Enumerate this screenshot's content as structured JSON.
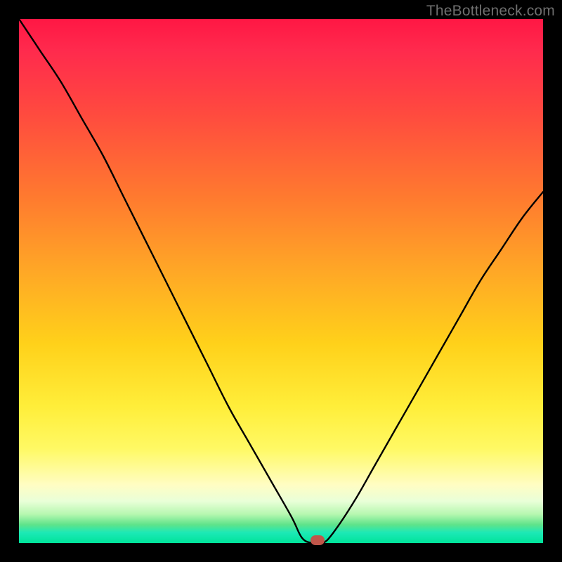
{
  "watermark": "TheBottleneck.com",
  "chart_data": {
    "type": "line",
    "title": "",
    "xlabel": "",
    "ylabel": "",
    "xlim": [
      0,
      100
    ],
    "ylim": [
      0,
      100
    ],
    "grid": false,
    "legend": false,
    "series": [
      {
        "name": "bottleneck-curve",
        "x": [
          0,
          4,
          8,
          12,
          16,
          20,
          24,
          28,
          32,
          36,
          40,
          44,
          48,
          52,
          54,
          56,
          58,
          60,
          64,
          68,
          72,
          76,
          80,
          84,
          88,
          92,
          96,
          100
        ],
        "y": [
          100,
          94,
          88,
          81,
          74,
          66,
          58,
          50,
          42,
          34,
          26,
          19,
          12,
          5,
          1,
          0,
          0,
          2,
          8,
          15,
          22,
          29,
          36,
          43,
          50,
          56,
          62,
          67
        ]
      }
    ],
    "marker": {
      "x": 57,
      "y": 0
    },
    "background_gradient": [
      {
        "stop": 0,
        "color": "#ff1744"
      },
      {
        "stop": 18,
        "color": "#ff4a3f"
      },
      {
        "stop": 48,
        "color": "#ffa726"
      },
      {
        "stop": 74,
        "color": "#ffee3a"
      },
      {
        "stop": 92,
        "color": "#e9ffd8"
      },
      {
        "stop": 100,
        "color": "#00e39a"
      }
    ]
  }
}
